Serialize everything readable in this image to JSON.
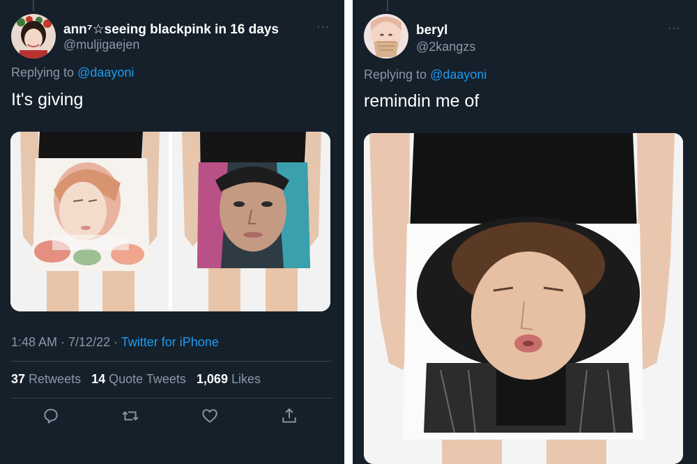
{
  "tweets": [
    {
      "display_name": "ann⁷☆seeing blackpink in 16 days",
      "handle": "@muljigaejen",
      "more": "···",
      "replying_prefix": "Replying to",
      "replying_to": "@daayoni",
      "text": "It's giving",
      "timestamp": "1:48 AM · 7/12/22 · ",
      "source": "Twitter for iPhone",
      "retweets_count": "37",
      "retweets_label": "Retweets",
      "quotes_count": "14",
      "quotes_label": "Quote Tweets",
      "likes_count": "1,069",
      "likes_label": "Likes",
      "actions": [
        "reply-icon",
        "retweet-icon",
        "like-icon",
        "share-icon"
      ]
    },
    {
      "display_name": "beryl",
      "handle": "@2kangzs",
      "more": "···",
      "replying_prefix": "Replying to",
      "replying_to": "@daayoni",
      "text": "remindin me of"
    }
  ],
  "colors": {
    "background": "#15202b",
    "text": "#ffffff",
    "muted": "#8b98a5",
    "accent": "#1d9bf0",
    "divider": "#38444d"
  }
}
